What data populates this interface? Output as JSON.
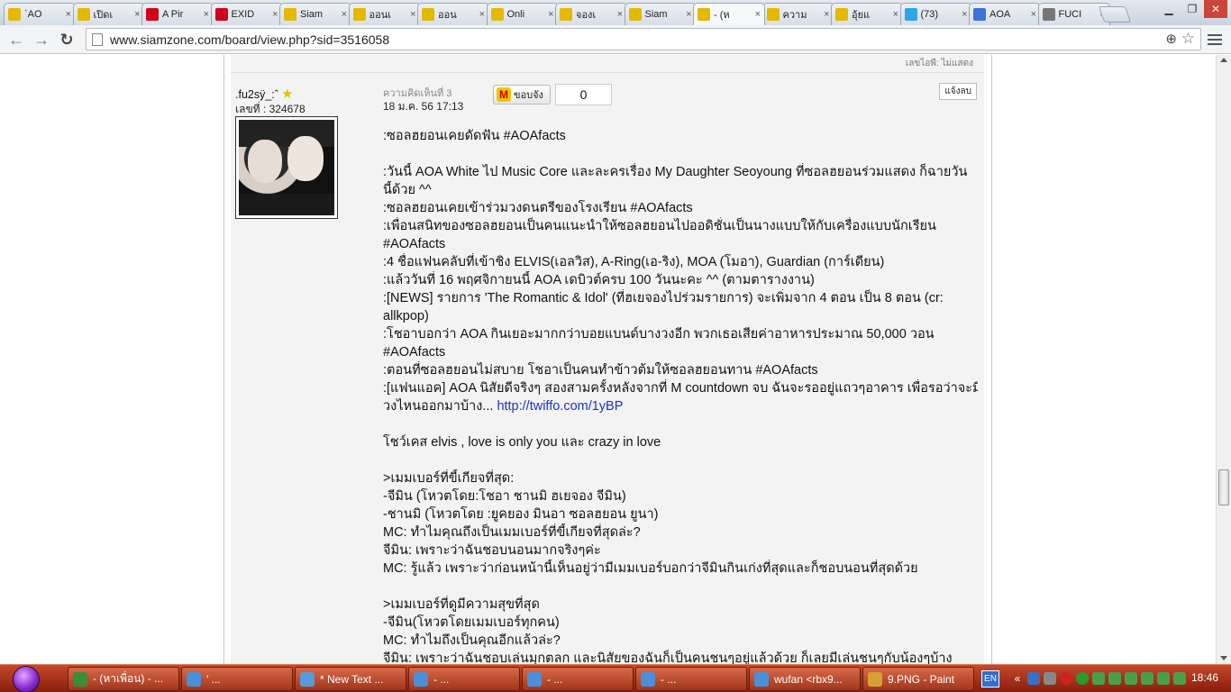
{
  "browser": {
    "tabs": [
      {
        "label": "`AO",
        "icon": "siamzone-icon",
        "color": "#e6b800"
      },
      {
        "label": "เปิดเ",
        "icon": "siamzone-icon",
        "color": "#e6b800"
      },
      {
        "label": "A Pir",
        "icon": "youtube-icon",
        "color": "#d0021b"
      },
      {
        "label": "EXID",
        "icon": "youtube-icon",
        "color": "#d0021b"
      },
      {
        "label": "Siam",
        "icon": "siamzone-icon",
        "color": "#e6b800"
      },
      {
        "label": "ออนเ",
        "icon": "siamzone-icon",
        "color": "#e6b800"
      },
      {
        "label": "ออน",
        "icon": "siamzone-icon",
        "color": "#e6b800"
      },
      {
        "label": "Onli",
        "icon": "siamzone-icon",
        "color": "#e6b800"
      },
      {
        "label": "จองเ",
        "icon": "siamzone-icon",
        "color": "#e6b800"
      },
      {
        "label": "Siam",
        "icon": "siamzone-icon",
        "color": "#e6b800"
      },
      {
        "label": "- (ห",
        "icon": "siamzone-icon",
        "color": "#e6b800",
        "active": true
      },
      {
        "label": "ความ",
        "icon": "siamzone-icon",
        "color": "#e6b800"
      },
      {
        "label": "อุ้ยแ",
        "icon": "siamzone-icon",
        "color": "#e6b800"
      },
      {
        "label": "(73)",
        "icon": "twitter-icon",
        "color": "#2fa4e7"
      },
      {
        "label": "AOA",
        "icon": "google-icon",
        "color": "#3b73d8"
      },
      {
        "label": "FUCI",
        "icon": "page-icon",
        "color": "#777777"
      }
    ],
    "tab_close": "×",
    "window_controls": {
      "minimize": "▁",
      "restore": "❐",
      "close": "✕"
    },
    "back_glyph": "←",
    "forward_glyph": "→",
    "reload_glyph": "↻",
    "url": "www.siamzone.com/board/view.php?sid=3516058",
    "zoom_glyph": "⊕",
    "star_glyph": "☆"
  },
  "page": {
    "prev_footer": "เลขไอพี: ไม่แสดง",
    "author": {
      "username": ".fu2sÿ_:ˆ",
      "star": "★",
      "member_id": "เลขที่ : 324678"
    },
    "comment": {
      "label": "ความคิดเห็นที่ 3",
      "date": "18 ม.ค. 56 17:13",
      "thanks_icon": "M",
      "thanks_label": "ขอบจัง",
      "thanks_count": "0",
      "report_label": "แจ้งลบ"
    },
    "lines": [
      ":ซอลฮยอนเคยดัดฟัน #AOAfacts",
      "",
      ":วันนี้ AOA White ไป Music Core และละครเรื่อง My Daughter Seoyoung ที่ซอลฮยอนร่วมแสดง ก็ฉายวัน",
      "นี้ด้วย ^^",
      ":ซอลฮยอนเคยเข้าร่วมวงดนตรีของโรงเรียน #AOAfacts",
      ":เพื่อนสนิทของซอลฮยอนเป็นคนแนะนำให้ซอลฮยอนไปออดิชั่นเป็นนางแบบให้กับเครื่องแบบนักเรียน",
      "#AOAfacts",
      ":4 ชื่อแฟนคลับที่เข้าชิง ELVIS(เอลวิส), A-Ring(เอ-ริง), MOA (โมอา), Guardian (การ์เดียน)",
      ":แล้ววันที่ 16 พฤศจิกายนนี้ AOA เดบิวต์ครบ 100 วันนะคะ ^^ (ตามตารางงาน)",
      ":[NEWS] รายการ 'The Romantic & Idol' (ที่ฮเยจองไปร่วมรายการ) จะเพิ่มจาก 4 ตอน เป็น 8 ตอน (cr:",
      "allkpop)",
      ":โชอาบอกว่า AOA กินเยอะมากกว่าบอยแบนด์บางวงอีก พวกเธอเสียค่าอาหารประมาณ 50,000 วอน",
      "#AOAfacts",
      ":ตอนที่ซอลฮยอนไม่สบาย โชอาเป็นคนทำข้าวต้มให้ซอลฮยอนทาน #AOAfacts",
      ":[แฟนแอค] AOA นิสัยดีจริงๆ สองสามครั้งหลังจากที่ M countdown จบ ฉันจะรออยู่แถวๆอาคาร เพื่อรอว่าจะมี"
    ],
    "link_prefix": "วงไหนออกมาบ้าง...",
    "link_text": "http://twiffo.com/1yBP",
    "lines2": [
      "",
      "โชว์เคส elvis , love is only you และ crazy in love",
      "",
      ">เมมเบอร์ที่ขี้เกียจที่สุด:",
      "-จีมิน (โหวตโดย:โชอา ชานมิ ฮเยจอง จีมิน)",
      "-ชานมิ (โหวตโดย :ยูคยอง มินอา ซอลฮยอน ยูนา)",
      "MC: ทำไมคุณถึงเป็นเมมเบอร์ที่ขี้เกียจที่สุดล่ะ?",
      "จีมิน: เพราะว่าฉันชอบนอนมากจริงๆค่ะ",
      "MC: รู้แล้ว เพราะว่าก่อนหน้านี้เห็นอยู่ว่ามีเมมเบอร์บอกว่าจีมินกินเก่งที่สุดและก็ชอบนอนที่สุดด้วย",
      "",
      ">เมมเบอร์ที่ดูมีความสุขที่สุด",
      "-จีมิน(โหวตโดยเมมเบอร์ทุกคน)",
      "MC: ทำไมถึงเป็นคุณอีกแล้วล่ะ?",
      "จีมิน: เพราะว่าฉันชอบเล่นมุกตลก และนิสัยของฉันก็เป็นคนชนๆอยู่แล้วด้วย ก็เลยมีเล่นชนๆกับน้องๆบ้าง"
    ]
  },
  "taskbar": {
    "tasks": [
      {
        "label": "- (หาเพื่อน) - ...",
        "icon": "chrome-icon",
        "color": "#3a8e3a"
      },
      {
        "label": "' ...",
        "icon": "messenger-icon",
        "color": "#4a8fd8"
      },
      {
        "label": "* New Text ...",
        "icon": "notepad-icon",
        "color": "#5a9ad8"
      },
      {
        "label": "- ...",
        "icon": "messenger-icon",
        "color": "#4a8fd8"
      },
      {
        "label": "- ...",
        "icon": "messenger-icon",
        "color": "#4a8fd8"
      },
      {
        "label": "- ...",
        "icon": "messenger-icon",
        "color": "#4a8fd8"
      },
      {
        "label": "wufan <rbx9...",
        "icon": "messenger-icon",
        "color": "#4a8fd8"
      },
      {
        "label": "9.PNG - Paint",
        "icon": "paint-icon",
        "color": "#d8a030"
      }
    ],
    "lang": "EN",
    "clock": "18:46"
  }
}
